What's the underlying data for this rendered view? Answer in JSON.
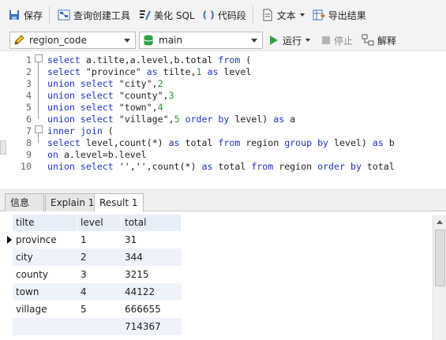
{
  "toolbar": {
    "save": "保存",
    "query_builder": "查询创建工具",
    "beautify_sql": "美化 SQL",
    "code_snippet": "代码段",
    "text": "文本",
    "export_results": "导出结果"
  },
  "bar2": {
    "connection": "region_code",
    "database": "main",
    "run": "运行",
    "stop": "停止",
    "explain": "解释"
  },
  "editor": {
    "lines": [
      {
        "n": "1",
        "segs": [
          {
            "t": "select",
            "c": "kw"
          },
          {
            "t": " a.tilte,a.level,b.total ",
            "c": ""
          },
          {
            "t": "from",
            "c": "kw"
          },
          {
            "t": " (",
            "c": ""
          }
        ]
      },
      {
        "n": "2",
        "segs": [
          {
            "t": "select",
            "c": "kw"
          },
          {
            "t": " \"province\" ",
            "c": "str"
          },
          {
            "t": "as",
            "c": "kw"
          },
          {
            "t": " tilte,",
            "c": ""
          },
          {
            "t": "1",
            "c": "num"
          },
          {
            "t": " ",
            "c": ""
          },
          {
            "t": "as",
            "c": "kw"
          },
          {
            "t": " level",
            "c": ""
          }
        ]
      },
      {
        "n": "3",
        "segs": [
          {
            "t": "union",
            "c": "kw"
          },
          {
            "t": " ",
            "c": ""
          },
          {
            "t": "select",
            "c": "kw"
          },
          {
            "t": " \"city\",",
            "c": "str"
          },
          {
            "t": "2",
            "c": "num"
          }
        ]
      },
      {
        "n": "4",
        "segs": [
          {
            "t": "union",
            "c": "kw"
          },
          {
            "t": " ",
            "c": ""
          },
          {
            "t": "select",
            "c": "kw"
          },
          {
            "t": " \"county\",",
            "c": "str"
          },
          {
            "t": "3",
            "c": "num"
          }
        ]
      },
      {
        "n": "5",
        "segs": [
          {
            "t": "union",
            "c": "kw"
          },
          {
            "t": " ",
            "c": ""
          },
          {
            "t": "select",
            "c": "kw"
          },
          {
            "t": " \"town\",",
            "c": "str"
          },
          {
            "t": "4",
            "c": "num"
          }
        ]
      },
      {
        "n": "6",
        "segs": [
          {
            "t": "union",
            "c": "kw"
          },
          {
            "t": " ",
            "c": ""
          },
          {
            "t": "select",
            "c": "kw"
          },
          {
            "t": " \"village\",",
            "c": "str"
          },
          {
            "t": "5",
            "c": "num"
          },
          {
            "t": " ",
            "c": ""
          },
          {
            "t": "order",
            "c": "kw"
          },
          {
            "t": " ",
            "c": ""
          },
          {
            "t": "by",
            "c": "kw"
          },
          {
            "t": " level) ",
            "c": ""
          },
          {
            "t": "as",
            "c": "kw"
          },
          {
            "t": " a",
            "c": ""
          }
        ]
      },
      {
        "n": "7",
        "segs": [
          {
            "t": "inner",
            "c": "kw"
          },
          {
            "t": " ",
            "c": ""
          },
          {
            "t": "join",
            "c": "kw"
          },
          {
            "t": " (",
            "c": ""
          }
        ]
      },
      {
        "n": "8",
        "segs": [
          {
            "t": "select",
            "c": "kw"
          },
          {
            "t": " level,count(*) ",
            "c": ""
          },
          {
            "t": "as",
            "c": "kw"
          },
          {
            "t": " total ",
            "c": ""
          },
          {
            "t": "from",
            "c": "kw"
          },
          {
            "t": " region ",
            "c": ""
          },
          {
            "t": "group",
            "c": "kw"
          },
          {
            "t": " ",
            "c": ""
          },
          {
            "t": "by",
            "c": "kw"
          },
          {
            "t": " level) ",
            "c": ""
          },
          {
            "t": "as",
            "c": "kw"
          },
          {
            "t": " b",
            "c": ""
          }
        ]
      },
      {
        "n": "9",
        "segs": [
          {
            "t": "on",
            "c": "kw"
          },
          {
            "t": " a.level=b.level",
            "c": ""
          }
        ]
      },
      {
        "n": "10",
        "segs": [
          {
            "t": "union",
            "c": "kw"
          },
          {
            "t": " ",
            "c": ""
          },
          {
            "t": "select",
            "c": "kw"
          },
          {
            "t": " '','',count(*) ",
            "c": ""
          },
          {
            "t": "as",
            "c": "kw"
          },
          {
            "t": " total ",
            "c": ""
          },
          {
            "t": "from",
            "c": "kw"
          },
          {
            "t": " region ",
            "c": ""
          },
          {
            "t": "order",
            "c": "kw"
          },
          {
            "t": " ",
            "c": ""
          },
          {
            "t": "by",
            "c": "kw"
          },
          {
            "t": " total",
            "c": ""
          }
        ]
      }
    ]
  },
  "tabs": [
    "信息",
    "Explain 1",
    "Result 1"
  ],
  "result": {
    "columns": [
      "tilte",
      "level",
      "total"
    ],
    "rows": [
      [
        "province",
        "1",
        "31"
      ],
      [
        "city",
        "2",
        "344"
      ],
      [
        "county",
        "3",
        "3215"
      ],
      [
        "town",
        "4",
        "44122"
      ],
      [
        "village",
        "5",
        "666655"
      ],
      [
        "",
        "",
        "714367"
      ]
    ]
  },
  "colors": {
    "keyword": "#1e34c8",
    "number": "#2a9a2a",
    "header_bg": "#e8eef7",
    "row_alt": "#eef3fb",
    "run_green": "#2ea043"
  }
}
